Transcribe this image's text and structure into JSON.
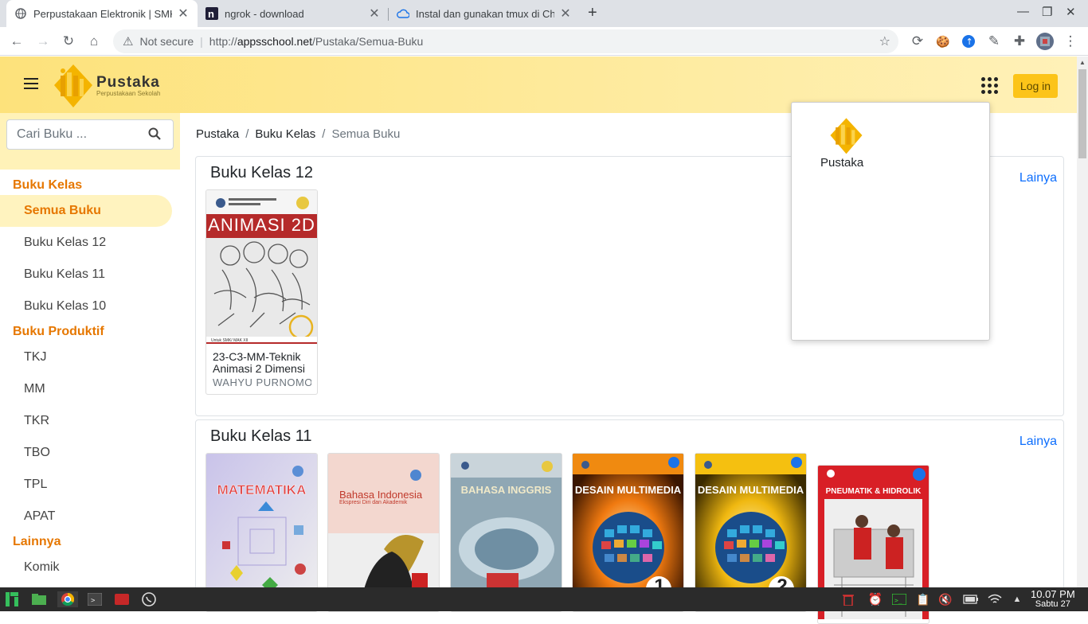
{
  "browser": {
    "tabs": [
      {
        "title": "Perpustakaan Elektronik | SMK"
      },
      {
        "title": "ngrok - download"
      },
      {
        "title": "Instal dan gunakan tmux di Chr"
      }
    ],
    "security_label": "Not secure",
    "url_scheme": "http://",
    "url_host": "appsschool.net",
    "url_path": "/Pustaka/Semua-Buku"
  },
  "header": {
    "brand": "Pustaka",
    "brand_sub": "Perpustakaan Sekolah",
    "login_label": "Log in"
  },
  "sidebar": {
    "search_placeholder": "Cari Buku ...",
    "sections": [
      {
        "title": "Buku Kelas",
        "items": [
          "Semua Buku",
          "Buku Kelas 12",
          "Buku Kelas 11",
          "Buku Kelas 10"
        ]
      },
      {
        "title": "Buku Produktif",
        "items": [
          "TKJ",
          "MM",
          "TKR",
          "TBO",
          "TPL",
          "APAT"
        ]
      },
      {
        "title": "Lainnya",
        "items": [
          "Komik"
        ]
      }
    ]
  },
  "breadcrumb": [
    "Pustaka",
    "Buku Kelas",
    "Semua Buku"
  ],
  "sections": [
    {
      "title": "Buku Kelas 12",
      "more": "Lainya",
      "books": [
        {
          "title": "23-C3-MM-Teknik Animasi 2 Dimensi",
          "author": "WAHYU PURNOMO",
          "cover_text": "ANIMASI 2D"
        }
      ]
    },
    {
      "title": "Buku Kelas 11",
      "more": "Lainya",
      "books": [
        {
          "cover_text": "MATEMATIKA"
        },
        {
          "cover_text": "Bahasa Indonesia",
          "cover_sub": "Ekspresi Diri dan Akademik"
        },
        {
          "cover_text": "BAHASA INGGRIS"
        },
        {
          "cover_text": "DESAIN MULTIMEDIA",
          "cover_num": "1"
        },
        {
          "cover_text": "DESAIN MULTIMEDIA",
          "cover_num": "2"
        },
        {
          "cover_text": "PNEUMATIK & HIDROLIK"
        }
      ]
    }
  ],
  "apps_menu": {
    "items": [
      "Pustaka"
    ]
  },
  "taskbar": {
    "time": "10.07 PM",
    "day": "Sabtu 27"
  },
  "colors": {
    "header": "#fde27b",
    "accent": "#e67700",
    "link": "#0d6efd",
    "login": "#fcc419"
  }
}
